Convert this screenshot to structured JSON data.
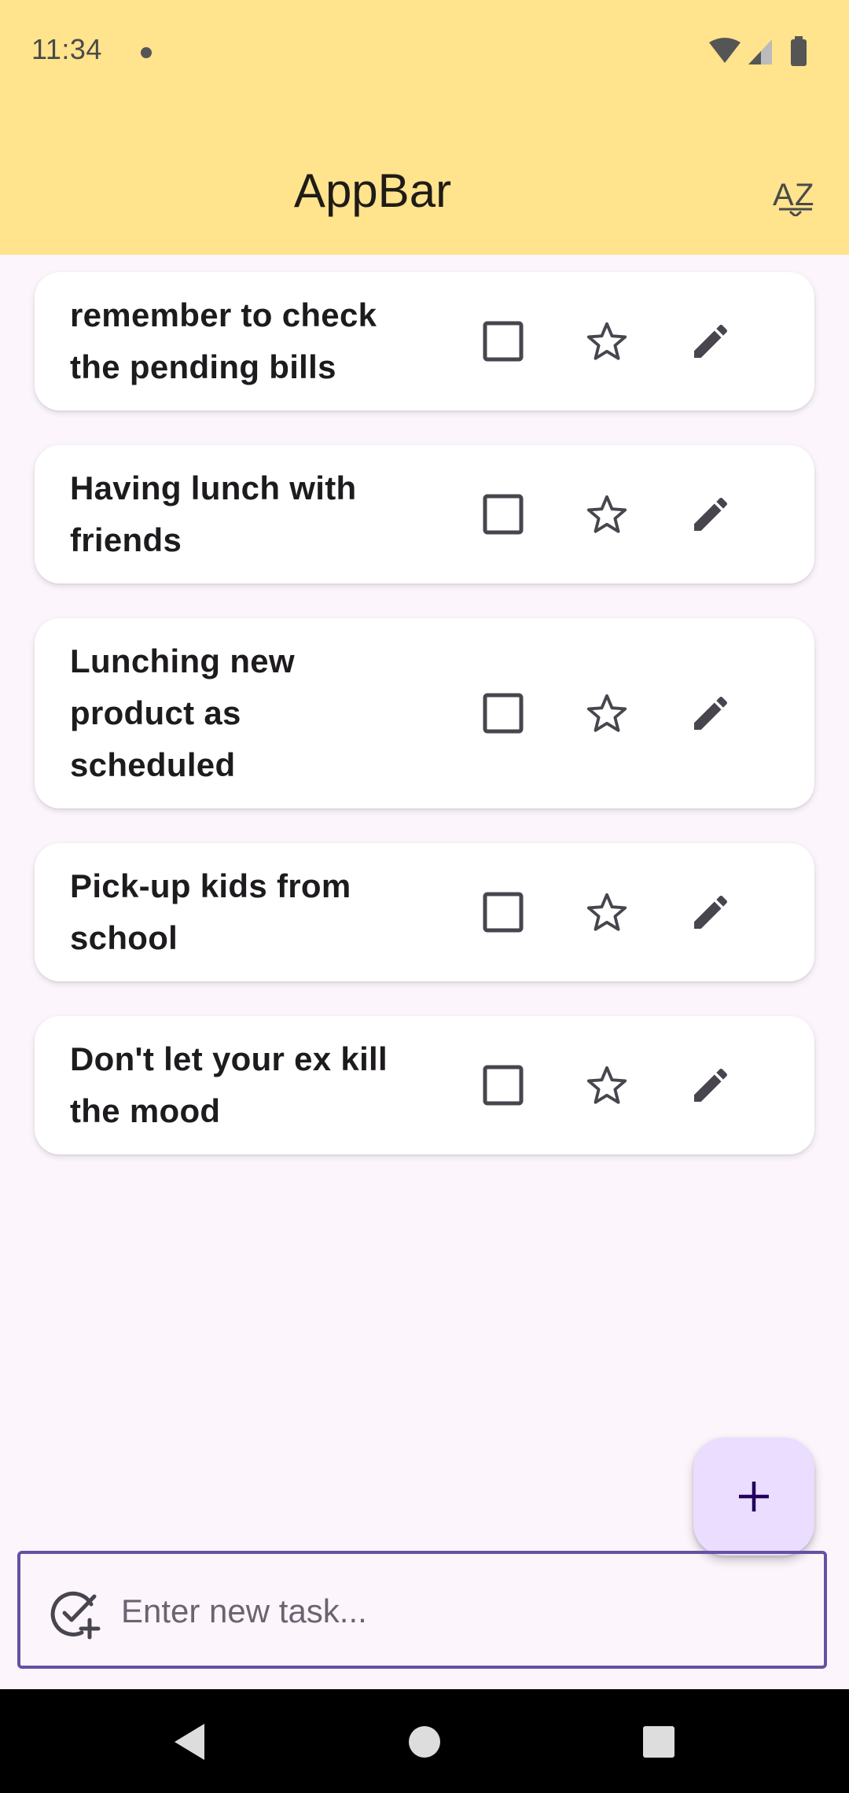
{
  "status_bar": {
    "time": "11:34",
    "icons": [
      "notification-dot-icon",
      "wifi-icon",
      "signal-icon",
      "battery-icon"
    ]
  },
  "app_bar": {
    "title": "AppBar",
    "sort_icon": "sort-alpha-icon"
  },
  "tasks": [
    {
      "text": "remember to check the pending bills",
      "completed": false,
      "starred": false
    },
    {
      "text": "Having lunch with friends",
      "completed": false,
      "starred": false
    },
    {
      "text": "Lunching new product as scheduled",
      "completed": false,
      "starred": false
    },
    {
      "text": "Pick-up kids from school",
      "completed": false,
      "starred": false
    },
    {
      "text": "Don't let your ex kill the mood",
      "completed": false,
      "starred": false
    }
  ],
  "fab": {
    "icon": "plus-icon"
  },
  "new_task_input": {
    "placeholder": "Enter new task...",
    "value": "",
    "icon": "add-task-icon"
  },
  "nav_bar": {
    "buttons": [
      "back-icon",
      "home-icon",
      "recents-icon"
    ]
  },
  "colors": {
    "app_bar": "#ffe38d",
    "background": "#fcf6fc",
    "fab": "#eaddff",
    "input_border": "#6750a4",
    "icon": "#49454f"
  }
}
